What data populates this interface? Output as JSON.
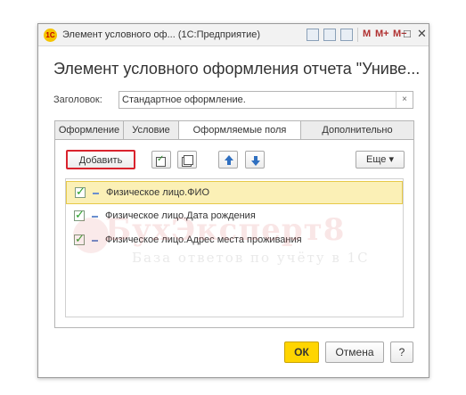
{
  "window": {
    "logo_text": "1C",
    "title": "Элемент условного оф... (1С:Предприятие)",
    "toolbar_labels": [
      "M",
      "M+",
      "M−"
    ],
    "minimize": "□",
    "close": "✕"
  },
  "form": {
    "heading": "Элемент условного оформления отчета \"Униве...",
    "title_label": "Заголовок:",
    "title_value": "Стандартное оформление.",
    "clear": "×"
  },
  "tabs": [
    {
      "label": "Оформление"
    },
    {
      "label": "Условие"
    },
    {
      "label": "Оформляемые поля"
    },
    {
      "label": "Дополнительно"
    }
  ],
  "toolbar": {
    "add": "Добавить",
    "more": "Еще ▾"
  },
  "fields": [
    {
      "label": "Физическое лицо.ФИО",
      "checked": true
    },
    {
      "label": "Физическое лицо.Дата рождения",
      "checked": true
    },
    {
      "label": "Физическое лицо.Адрес места проживания",
      "checked": true
    }
  ],
  "watermark": {
    "name": "БухЭксперт8",
    "tagline": "База ответов по учёту в 1С"
  },
  "buttons": {
    "ok": "ОК",
    "cancel": "Отмена",
    "help": "?"
  },
  "colors": {
    "accent_yellow": "#ffd500",
    "highlight_red": "#d9232d",
    "selection": "#fbf0b6"
  }
}
